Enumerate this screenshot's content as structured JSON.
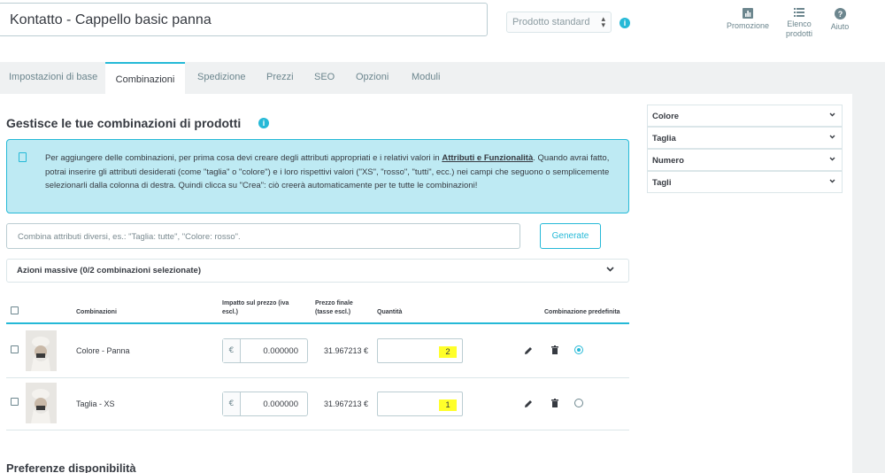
{
  "header": {
    "product_name": "Kontatto - Cappello basic panna",
    "product_type": "Prodotto standard",
    "tools": [
      {
        "label": "Promozione",
        "icon": "chart-icon"
      },
      {
        "label_line1": "Elenco",
        "label_line2": "prodotti",
        "icon": "list-icon"
      },
      {
        "label": "Aiuto",
        "icon": "help-icon"
      }
    ]
  },
  "tabs": [
    {
      "label": "Impostazioni di base"
    },
    {
      "label": "Combinazioni",
      "active": true
    },
    {
      "label": "Spedizione"
    },
    {
      "label": "Prezzi"
    },
    {
      "label": "SEO"
    },
    {
      "label": "Opzioni"
    },
    {
      "label": "Moduli"
    }
  ],
  "combinations": {
    "title": "Gestisce le tue combinazioni di prodotti",
    "alert": {
      "text_before_link": "Per aggiungere delle combinazioni, per prima cosa devi creare degli attributi appropriati e i relativi valori in ",
      "link": "Attributi e Funzionalità",
      "text_after_link": ". Quando avrai fatto, potrai inserire gli attributi desiderati (come \"taglia\" o \"colore\") e i loro rispettivi valori (\"XS\", \"rosso\", \"tutti\", ecc.) nei campi che seguono o semplicemente selezionarli dalla colonna di destra. Quindi clicca su \"Crea\": ciò creerà automaticamente per te tutte le combinazioni!"
    },
    "combine_placeholder": "Combina attributi diversi, es.: \"Taglia: tutte\", \"Colore: rosso\".",
    "generate_label": "Generate",
    "bulk_label": "Azioni massive (0/2 combinazioni selezionate)",
    "columns": {
      "combination": "Combinazioni",
      "impact_line1": "Impatto sul prezzo (iva",
      "impact_line2": "escl.)",
      "final_line1": "Prezzo finale",
      "final_line2": "(tasse escl.)",
      "quantity": "Quantità",
      "default": "Combinazione predefinita"
    },
    "rows": [
      {
        "name": "Colore - Panna",
        "currency": "€",
        "impact": "0.000000",
        "final_price": "31.967213 €",
        "quantity": "2",
        "default": true
      },
      {
        "name": "Taglia - XS",
        "currency": "€",
        "impact": "0.000000",
        "final_price": "31.967213 €",
        "quantity": "1",
        "default": false
      }
    ]
  },
  "availability_title": "Preferenze disponibilità",
  "attributes": [
    {
      "label": "Colore"
    },
    {
      "label": "Taglia"
    },
    {
      "label": "Numero"
    },
    {
      "label": "Tagli"
    }
  ],
  "colors": {
    "accent": "#25b9d7",
    "alert_bg": "#beeaf3",
    "highlight": "#ffff2a"
  }
}
